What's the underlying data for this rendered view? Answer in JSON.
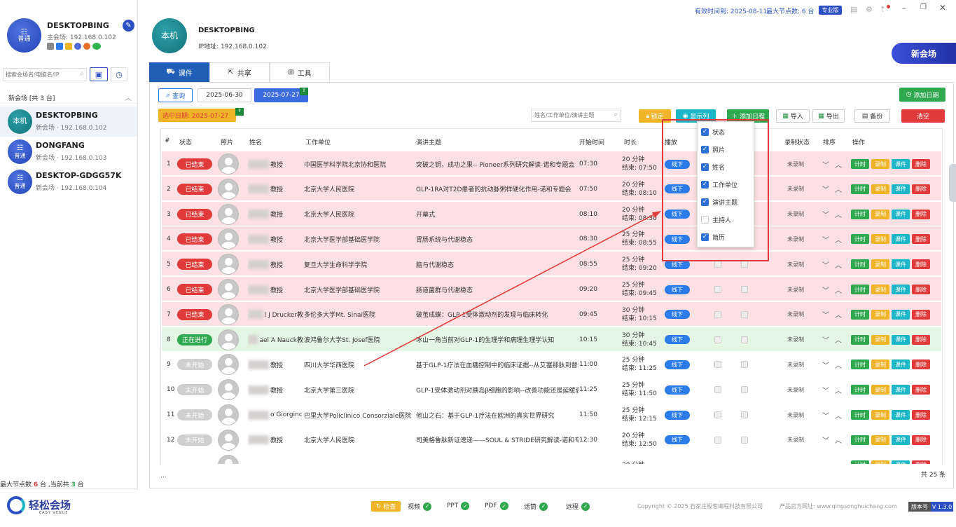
{
  "window": {
    "validity": "有效时间到: 2025-08-11",
    "max_nodes": "最大节点数: 6 台",
    "edition": "专业版"
  },
  "sidebar": {
    "me": {
      "avatar_line1": "普通",
      "name": "DESKTOPBING",
      "host_ip": "主会场: 192.168.0.102"
    },
    "search_placeholder": "搜索会场名/电脑名/IP",
    "group_title": "新会场 [共 3 台]",
    "items": [
      {
        "avatar": "本机",
        "name": "DESKTOPBING",
        "sub": "新会场 · 192.168.0.102"
      },
      {
        "avatar": "普通",
        "name": "DONGFANG",
        "sub": "新会场 · 192.168.0.103"
      },
      {
        "avatar": "普通",
        "name": "DESKTOP-GDGG57K",
        "sub": "新会场 · 192.168.0.104"
      }
    ],
    "footer": {
      "prefix": "最大节点数 ",
      "max": "6",
      "mid": " 台 ,当前共 ",
      "cur": "3",
      "suffix": " 台"
    },
    "logo_text": "轻松会场",
    "logo_sub": "EASY VENUE"
  },
  "header": {
    "avatar": "本机",
    "name": "DESKTOPBING",
    "ip": "IP地址: 192.168.0.102",
    "new_venue": "新会场"
  },
  "tabs": [
    {
      "label": "课件"
    },
    {
      "label": "共享"
    },
    {
      "label": "工具"
    }
  ],
  "toolbar": {
    "query": "查询",
    "date_from": "2025-06-30",
    "date_to": "2025-07-27",
    "add_date": "添加日期",
    "selected_date": "选中日期:  2025-07-27",
    "search_placeholder": "姓名/工作单位/演讲主题",
    "lock": "锁定",
    "show_cols": "显示列",
    "add_schedule": "添加日程",
    "import": "导入",
    "export": "导出",
    "backup": "备份",
    "clear": "清空"
  },
  "table": {
    "headers": [
      "#",
      "状态",
      "照片",
      "姓名",
      "工作单位",
      "演讲主题",
      "开始时间",
      "时长",
      "播放",
      "录制状态",
      "排序",
      "操作"
    ],
    "actions": [
      "计时",
      "录制",
      "课件",
      "删除"
    ],
    "rows": [
      {
        "n": "1",
        "status": "已结束",
        "st": "done",
        "name": "教授",
        "org": "中国医学科学院北京协和医院",
        "topic": "突破之钥，成功之果-- Pioneer系列研究解读-诺和专题会",
        "start": "07:30",
        "dur": "20 分钟",
        "end": "结束: 07:50",
        "mode": "线下",
        "rec": "未录制"
      },
      {
        "n": "2",
        "status": "已结束",
        "st": "done",
        "name": "教授",
        "org": "北京大学人民医院",
        "topic": "GLP-1RA对T2D患者的抗动脉粥样硬化作用-诺和专题会",
        "start": "07:50",
        "dur": "20 分钟",
        "end": "结束: 08:10",
        "mode": "线下",
        "rec": "未录制"
      },
      {
        "n": "3",
        "status": "已结束",
        "st": "done",
        "name": "教授",
        "org": "北京大学人民医院",
        "topic": "开幕式",
        "start": "08:10",
        "dur": "20 分钟",
        "end": "结束: 08:30",
        "mode": "线下",
        "rec": "未录制"
      },
      {
        "n": "4",
        "status": "已结束",
        "st": "done",
        "name": "教授",
        "org": "北京大学医学部基础医学院",
        "topic": "胃肠系统与代谢稳态",
        "start": "08:30",
        "dur": "25 分钟",
        "end": "结束: 08:55",
        "mode": "线下",
        "rec": "未录制"
      },
      {
        "n": "5",
        "status": "已结束",
        "st": "done",
        "name": "教授",
        "org": "复旦大学生命科学学院",
        "topic": "脑与代谢稳态",
        "start": "08:55",
        "dur": "25 分钟",
        "end": "结束: 09:20",
        "mode": "线下",
        "rec": "未录制"
      },
      {
        "n": "6",
        "status": "已结束",
        "st": "done",
        "name": "教授",
        "org": "北京大学医学部基础医学院",
        "topic": "肠道菌群与代谢稳态",
        "start": "09:20",
        "dur": "25 分钟",
        "end": "结束: 09:45",
        "mode": "线下",
        "rec": "未录制"
      },
      {
        "n": "7",
        "status": "已结束",
        "st": "done",
        "name": "l J Drucker教",
        "org": "多伦多大学Mt. Sinai医院",
        "topic": "破茧成蝶：GLP-1受体激动剂的发现与临床转化",
        "start": "09:45",
        "dur": "30 分钟",
        "end": "结束: 10:15",
        "mode": "线下",
        "rec": "未录制"
      },
      {
        "n": "8",
        "status": "正在进行",
        "st": "live",
        "name": "ael A Nauck教",
        "org": "波鸿鲁尔大学St. Josef医院",
        "topic": "冰山一角当前对GLP-1的生理学和病理生理学认知",
        "start": "10:15",
        "dur": "30 分钟",
        "end": "结束: 10:45",
        "mode": "线下",
        "rec": "未录制"
      },
      {
        "n": "9",
        "status": "未开始",
        "st": "todo",
        "name": "教授",
        "org": "四川大学华西医院",
        "topic": "基于GLP-1疗法在血糖控制中的临床证据--从艾塞那肽到替尔",
        "start": "11:00",
        "dur": "25 分钟",
        "end": "结束: 11:25",
        "mode": "线下",
        "rec": "未录制"
      },
      {
        "n": "10",
        "status": "未开始",
        "st": "todo",
        "name": "教授",
        "org": "北京大学第三医院",
        "topic": "GLP-1受体激动剂对胰岛β细胞的影响--改善功能还是延缓衰",
        "start": "11:25",
        "dur": "25 分钟",
        "end": "结束: 11:50",
        "mode": "线下",
        "rec": "未录制"
      },
      {
        "n": "11",
        "status": "未开始",
        "st": "todo",
        "name": "o Giorginc",
        "org": "巴里大学Policlinico Consorziale医院",
        "topic": "他山之石：基于GLP-1疗法在欧洲的真实世界研究",
        "start": "11:50",
        "dur": "25 分钟",
        "end": "结束: 12:15",
        "mode": "线下",
        "rec": "未录制"
      },
      {
        "n": "12",
        "status": "未开始",
        "st": "todo",
        "name": "教授",
        "org": "北京大学人民医院",
        "topic": "司美格鲁肽新证速递——SOUL & STRIDE研究解读-诺和专题",
        "start": "12:30",
        "dur": "20 分钟",
        "end": "结束: 12:50",
        "mode": "线下",
        "rec": "未录制"
      },
      {
        "n": "",
        "status": "",
        "st": "cut",
        "name": "",
        "org": "",
        "topic": "",
        "start": "",
        "dur": "20 分钟",
        "end": "",
        "mode": "",
        "rec": ""
      }
    ],
    "total": "共 25 条",
    "ellipsis": "..."
  },
  "column_menu": [
    {
      "label": "状态",
      "checked": true
    },
    {
      "label": "照片",
      "checked": true
    },
    {
      "label": "姓名",
      "checked": true
    },
    {
      "label": "工作单位",
      "checked": true
    },
    {
      "label": "演讲主题",
      "checked": true
    },
    {
      "label": "主持人",
      "checked": false
    },
    {
      "label": "简历",
      "checked": true
    }
  ],
  "footer": {
    "check": "检查",
    "items": [
      "视频",
      "PPT",
      "PDF",
      "话筒",
      "远程"
    ],
    "copyright": "Copyright © 2025 石家庄极客编程科技有限公司",
    "site": "产品官方网址: www.qingsonghuichang.com",
    "version_label": "版本号",
    "version": "V 1.3.0"
  },
  "colors": {
    "accent": "#1f5fb8",
    "done": "#e03a3a",
    "live": "#2fa84f",
    "todo": "#cfcfcf",
    "row_done_bg": "#fde0e3",
    "row_live_bg": "#e3f6e4"
  }
}
